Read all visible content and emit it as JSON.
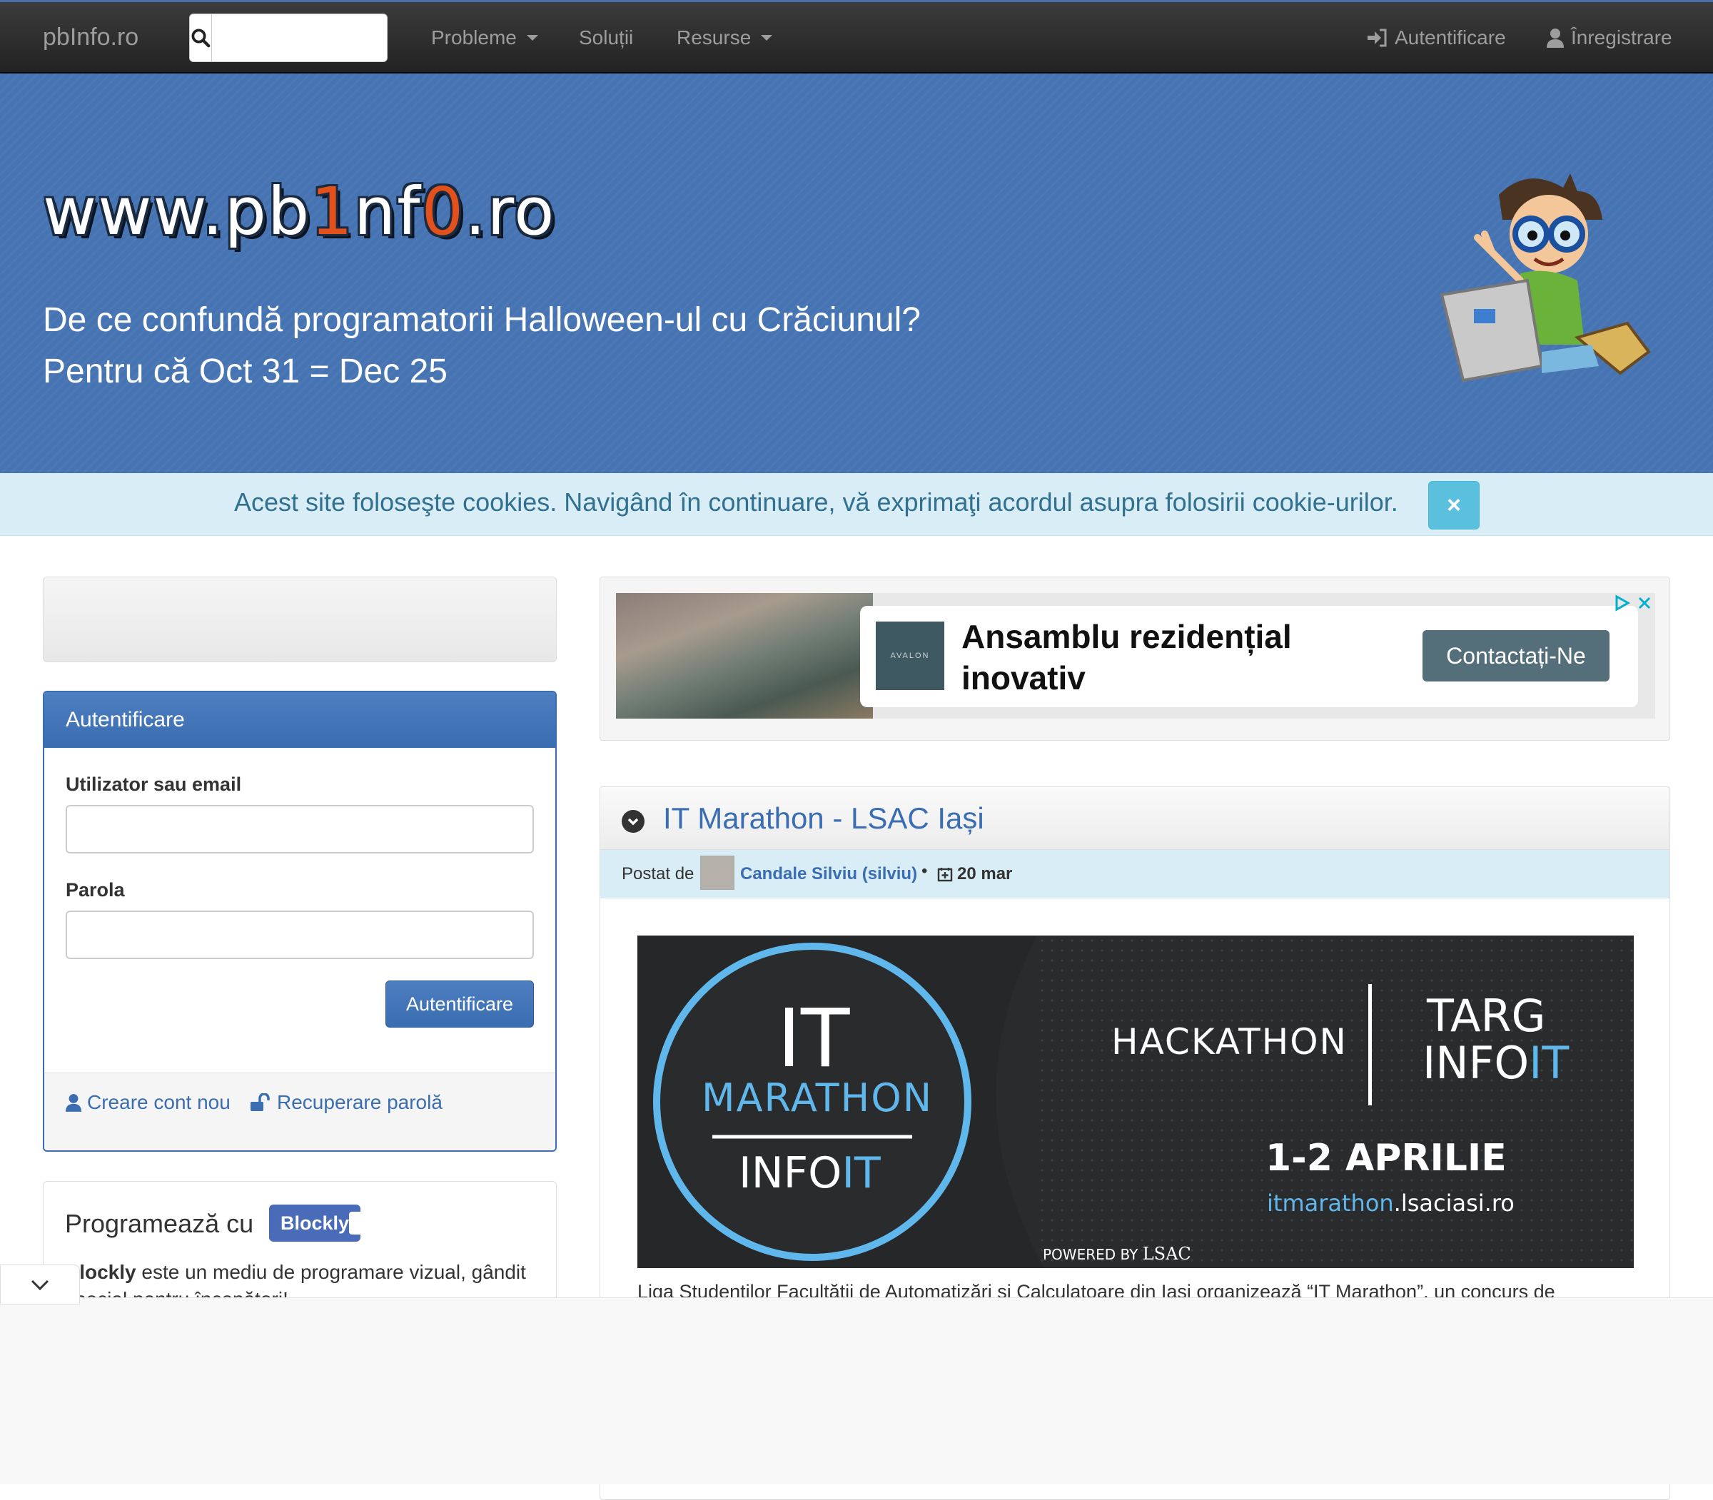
{
  "navbar": {
    "brand": "pbInfo.ro",
    "search_placeholder": "",
    "menu": [
      {
        "label": "Probleme"
      },
      {
        "label": "Soluții"
      },
      {
        "label": "Resurse"
      }
    ],
    "login_label": "Autentificare",
    "register_label": "Înregistrare"
  },
  "hero": {
    "logo_text": {
      "part1": "www.pb",
      "hl1": "1",
      "part2": "nf",
      "hl2": "0",
      "part3": ".ro"
    },
    "joke_line1": "De ce confundă programatorii Halloween-ul cu Crăciunul?",
    "joke_line2": "Pentru că Oct 31 = Dec 25"
  },
  "cookies": {
    "text": "Acest site foloseşte cookies. Navigând în continuare, vă exprimaţi acordul asupra folosirii cookie-urilor.",
    "close": "×"
  },
  "login": {
    "title": "Autentificare",
    "user_label": "Utilizator sau email",
    "password_label": "Parola",
    "submit": "Autentificare",
    "create_account": "Creare cont nou",
    "recover_password": "Recuperare parolă"
  },
  "blockly": {
    "title": "Programează cu",
    "badge": "Blockly",
    "text_bold": "Blockly",
    "text_rest": " este un mediu de programare vizual, gândit special pentru începători!"
  },
  "ad": {
    "title_line1": "Ansamblu rezidențial",
    "title_line2": "inovativ",
    "button": "Contactați-Ne",
    "logo_text": "AVALON"
  },
  "article": {
    "title": "IT Marathon - LSAC Iași",
    "posted_by": "Postat de",
    "author": "Candale Silviu (silviu)",
    "separator": "•",
    "date": "20 mar",
    "banner": {
      "it": "IT",
      "marathon": "MARATHON",
      "infoit_a": "INFO",
      "infoit_b": "IT",
      "hackathon": "HACKATHON",
      "targ": "TARG",
      "targ_info_a": "INFO",
      "targ_info_b": "IT",
      "dates": "1-2 APRILIE",
      "url_a": "itmarathon",
      "url_b": ".lsaciasi.ro",
      "powered": "POWERED BY",
      "lsac": "LSAC"
    },
    "body": "Liga Studenților Facultății de Automatizări și Calculatoare din Iași organizează “IT Marathon”, un concurs de"
  },
  "colors": {
    "navbar": "#222222",
    "hero": "#4674b2",
    "accent": "#3a6db1",
    "cookie_bg": "#d9edf7",
    "banner_accent": "#5fb7ec"
  }
}
